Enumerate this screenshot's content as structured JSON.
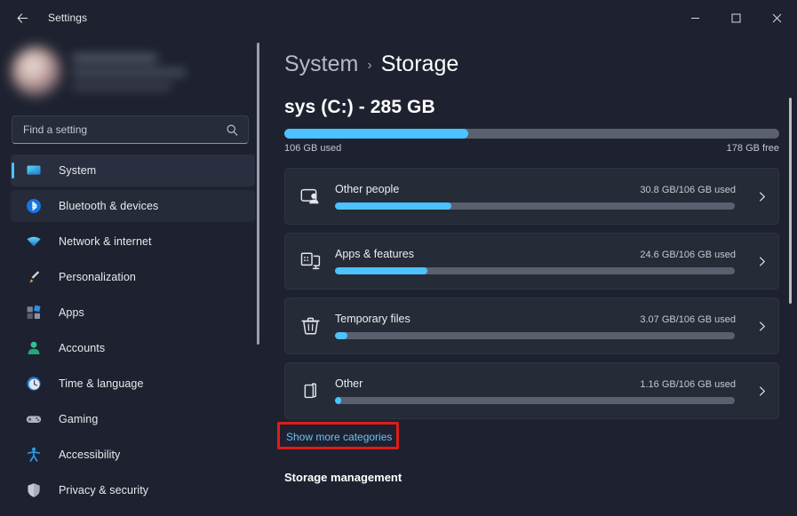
{
  "titlebar": {
    "back_icon": "arrow-left-icon",
    "title": "Settings",
    "minimize_label": "—",
    "maximize_label": "☐",
    "close_label": "✕"
  },
  "sidebar": {
    "profile": {
      "blurred": true
    },
    "search": {
      "placeholder": "Find a setting",
      "value": "",
      "icon": "search-icon"
    },
    "items": [
      {
        "label": "System",
        "icon": "monitor-icon",
        "selected": true,
        "hover": false
      },
      {
        "label": "Bluetooth & devices",
        "icon": "bluetooth-icon",
        "selected": false,
        "hover": true
      },
      {
        "label": "Network & internet",
        "icon": "wifi-icon",
        "selected": false,
        "hover": false
      },
      {
        "label": "Personalization",
        "icon": "paintbrush-icon",
        "selected": false,
        "hover": false
      },
      {
        "label": "Apps",
        "icon": "apps-grid-icon",
        "selected": false,
        "hover": false
      },
      {
        "label": "Accounts",
        "icon": "person-icon",
        "selected": false,
        "hover": false
      },
      {
        "label": "Time & language",
        "icon": "clock-icon",
        "selected": false,
        "hover": false
      },
      {
        "label": "Gaming",
        "icon": "gamepad-icon",
        "selected": false,
        "hover": false
      },
      {
        "label": "Accessibility",
        "icon": "accessibility-icon",
        "selected": false,
        "hover": false
      },
      {
        "label": "Privacy & security",
        "icon": "shield-icon",
        "selected": false,
        "hover": false
      }
    ]
  },
  "main": {
    "breadcrumb": {
      "parent": "System",
      "separator": "›",
      "current": "Storage"
    },
    "drive": {
      "title": "sys (C:) - 285 GB",
      "used_label": "106 GB used",
      "free_label": "178 GB free",
      "used_percent": 37.2
    },
    "categories": [
      {
        "name": "Other people",
        "value": "30.8 GB/106 GB used",
        "percent": 29.0,
        "icon": "other-people-icon",
        "chevron": "chevron-right-icon"
      },
      {
        "name": "Apps & features",
        "value": "24.6 GB/106 GB used",
        "percent": 23.2,
        "icon": "apps-features-icon",
        "chevron": "chevron-right-icon"
      },
      {
        "name": "Temporary files",
        "value": "3.07 GB/106 GB used",
        "percent": 3.0,
        "icon": "trash-icon",
        "chevron": "chevron-right-icon"
      },
      {
        "name": "Other",
        "value": "1.16 GB/106 GB used",
        "percent": 1.5,
        "icon": "documents-icon",
        "chevron": "chevron-right-icon"
      }
    ],
    "show_more_label": "Show more categories",
    "section_heading": "Storage management"
  },
  "colors": {
    "accent": "#4cc2ff",
    "link": "#6cc0f5",
    "highlight_border": "#e01b18",
    "page_bg": "#1e2230",
    "card_bg": "#252b37",
    "bar_track": "#5b6070"
  }
}
